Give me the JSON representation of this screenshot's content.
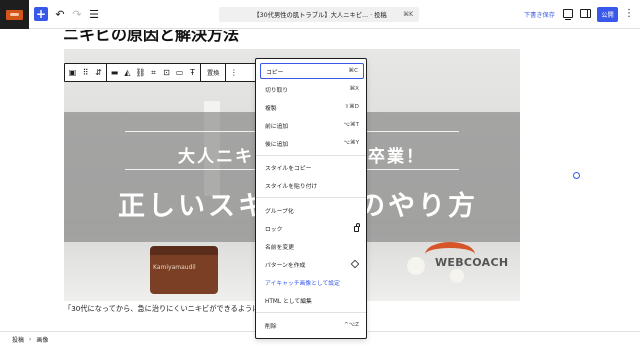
{
  "topbar": {
    "undo_icon": "undo-icon",
    "redo_icon": "redo-icon",
    "document_title": "【30代男性の肌トラブル】大人ニキビ... · 投稿",
    "document_shortcut": "⌘K",
    "save_draft": "下書き保存",
    "publish": "公開"
  },
  "content": {
    "heading_peek": "ニキビの原因と解決方法",
    "paragraph": "「30代になってから、急に治りにくいニキビができるように"
  },
  "image": {
    "title_line1": "大人ニキビ　　　　　卒業！",
    "title_line2": "正しいスキ　　　のやり方",
    "jar_label": "Kamiyamaudil",
    "logo_text": "WEBCOACH"
  },
  "block_toolbar": {
    "replace": "置換"
  },
  "menu": {
    "items": [
      {
        "label": "コピー",
        "shortcut": "⌘C"
      },
      {
        "label": "切り取り",
        "shortcut": "⌘X"
      },
      {
        "label": "複製",
        "shortcut": "⇧⌘D"
      },
      {
        "label": "前に追加",
        "shortcut": "⌥⌘T"
      },
      {
        "label": "後に追加",
        "shortcut": "⌥⌘Y"
      },
      {
        "label": "スタイルをコピー",
        "shortcut": ""
      },
      {
        "label": "スタイルを貼り付け",
        "shortcut": ""
      },
      {
        "label": "グループ化",
        "shortcut": ""
      },
      {
        "label": "ロック",
        "shortcut": ""
      },
      {
        "label": "名前を変更",
        "shortcut": ""
      },
      {
        "label": "パターンを作成",
        "shortcut": ""
      },
      {
        "label": "アイキャッチ画像として設定",
        "shortcut": ""
      },
      {
        "label": "HTML として編集",
        "shortcut": ""
      },
      {
        "label": "削除",
        "shortcut": "^⌥Z"
      }
    ]
  },
  "footer": {
    "crumb_post": "投稿",
    "crumb_separator": "›",
    "crumb_image": "画像"
  },
  "colors": {
    "accent": "#3858e9",
    "logo_bg": "#1e1e1e",
    "logo_orange": "#d45419"
  }
}
